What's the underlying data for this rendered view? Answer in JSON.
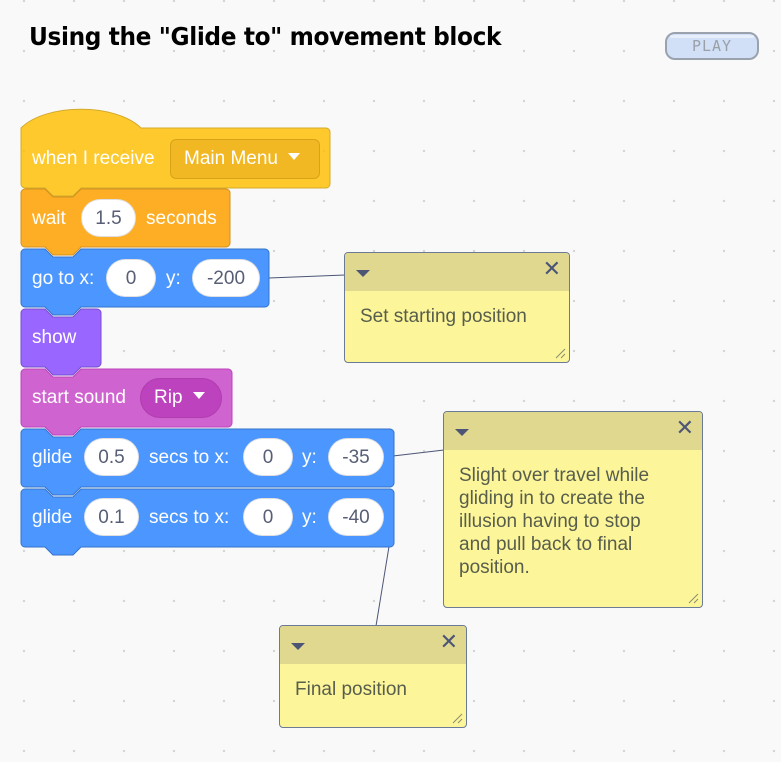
{
  "title": "Using the \"Glide to\" movement block",
  "play_button": {
    "label": "PLAY"
  },
  "colors": {
    "events": "#ffbf00",
    "control": "#ffab19",
    "motion": "#4c97ff",
    "looks": "#9966ff",
    "sound": "#cf63cf",
    "comment": "#fef49c"
  },
  "script": {
    "hat": {
      "label": "when I receive",
      "message": "Main Menu"
    },
    "wait": {
      "label": "wait",
      "value": "1.5",
      "suffix": "seconds"
    },
    "goto": {
      "label": "go to x:",
      "x": "0",
      "y_label": "y:",
      "y": "-200"
    },
    "show": {
      "label": "show"
    },
    "sound": {
      "label": "start sound",
      "sound": "Rip"
    },
    "glide1": {
      "label": "glide",
      "secs": "0.5",
      "mid_label": "secs to x:",
      "x": "0",
      "y_label": "y:",
      "y": "-35"
    },
    "glide2": {
      "label": "glide",
      "secs": "0.1",
      "mid_label": "secs to x:",
      "x": "0",
      "y_label": "y:",
      "y": "-40"
    }
  },
  "comments": [
    {
      "text": "Set starting position",
      "attached_to": "go to x: 0 y: -200"
    },
    {
      "text": "Slight over travel while gliding in to create the illusion having to stop and pull back to final position.",
      "attached_to": "glide 0.5 secs to x: 0 y: -35"
    },
    {
      "text": "Final position",
      "attached_to": "glide 0.1 secs to x: 0 y: -40"
    }
  ]
}
